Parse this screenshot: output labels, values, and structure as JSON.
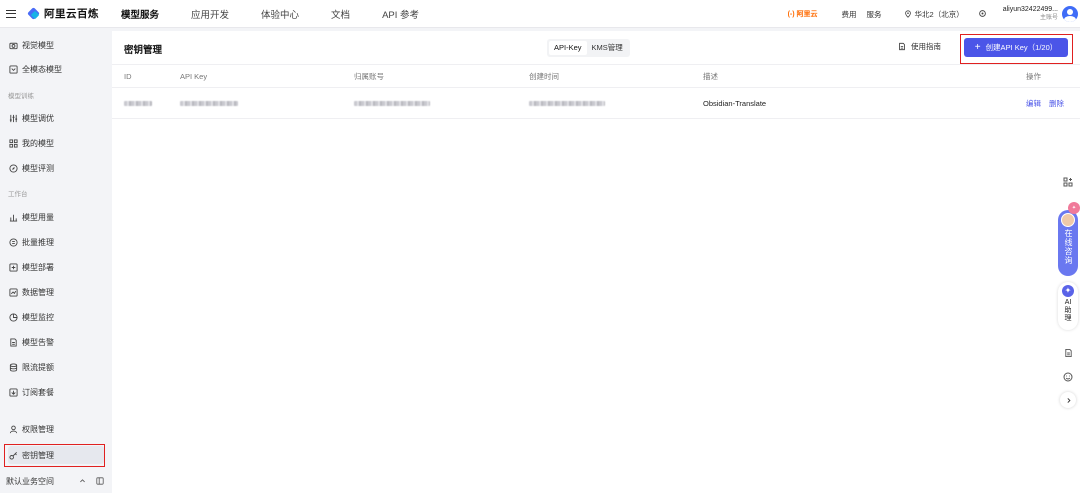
{
  "brand": {
    "name": "阿里云百炼"
  },
  "topnav": [
    "模型服务",
    "应用开发",
    "体验中心",
    "文档",
    "API 参考"
  ],
  "topright": {
    "aliyun_logo": "(-) 阿里云",
    "fees": "费用",
    "service": "服务",
    "region": "华北2（北京）",
    "account_name": "aliyun32422499...",
    "account_sub": "主账号"
  },
  "sidebar": {
    "items_top": [
      "视觉模型",
      "全模态模型"
    ],
    "group_train": "模型训练",
    "items_train": [
      "模型调优",
      "我的模型",
      "模型评测"
    ],
    "group_work": "工作台",
    "items_work": [
      "模型用量",
      "批量推理",
      "模型部署",
      "数据管理",
      "模型监控",
      "模型告警",
      "限流提额",
      "订阅套餐"
    ],
    "items_bottom": [
      "权限管理",
      "密钥管理"
    ],
    "workspace": "默认业务空间"
  },
  "page": {
    "title": "密钥管理",
    "tabs": [
      "API-Key",
      "KMS管理"
    ],
    "guide": "使用指南",
    "create_button": "创建API Key（1/20）"
  },
  "table": {
    "columns": [
      "ID",
      "API Key",
      "归属账号",
      "创建时间",
      "描述",
      "操作"
    ],
    "rows": [
      {
        "description": "Obsidian-Translate",
        "edit": "编辑",
        "delete": "删除"
      }
    ]
  },
  "floatbar": {
    "consult": "在线咨询",
    "ai_helper": "AI助理"
  },
  "colors": {
    "accent": "#4b55e8",
    "highlight": "#e02020",
    "brand_orange": "#ff6a00"
  }
}
